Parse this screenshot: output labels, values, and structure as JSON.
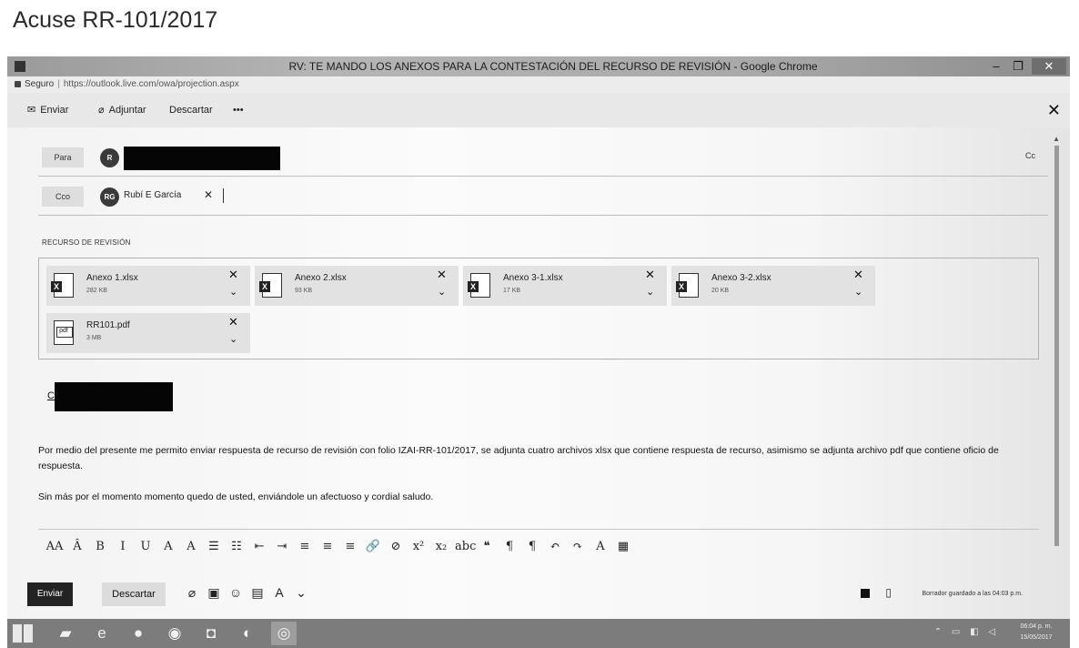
{
  "page_title": "Acuse RR-101/2017",
  "window": {
    "title": "RV: TE MANDO LOS ANEXOS PARA LA CONTESTACIÓN DEL RECURSO DE REVISIÓN - Google Chrome",
    "min_glyph": "–",
    "max_glyph": "❐",
    "close_glyph": "✕"
  },
  "address_bar": {
    "secure_label": "Seguro",
    "url": "https://outlook.live.com/owa/projection.aspx"
  },
  "toolbar": {
    "send_label": "Enviar",
    "attach_label": "Adjuntar",
    "discard_label": "Descartar",
    "more_label": "•••",
    "close_glyph": "✕"
  },
  "recipients": {
    "to_label": "Para",
    "to_avatar_initials": "R",
    "cc_label": "Cc",
    "bcc_label": "Cco",
    "bcc_avatar_initials": "RG",
    "bcc_name": "Rubí E García",
    "remove_glyph": "✕"
  },
  "subject": "RECURSO DE REVISIÓN",
  "attachments": [
    {
      "name": "Anexo 1.xlsx",
      "size": "282 KB",
      "icon": "excel-file-icon"
    },
    {
      "name": "Anexo 2.xlsx",
      "size": "93 KB",
      "icon": "excel-file-icon"
    },
    {
      "name": "Anexo 3-1.xlsx",
      "size": "17 KB",
      "icon": "excel-file-icon"
    },
    {
      "name": "Anexo 3-2.xlsx",
      "size": "20 KB",
      "icon": "excel-file-icon"
    },
    {
      "name": "RR101.pdf",
      "size": "3 MB",
      "icon": "pdf-file-icon"
    }
  ],
  "attachment_controls": {
    "remove_glyph": "✕",
    "more_glyph": "⌄"
  },
  "body": {
    "greeting": "C.",
    "paragraph_1": "Por medio del presente me permito enviar respuesta de recurso de revisión con folio IZAI-RR-101/2017, se adjunta cuatro archivos xlsx que contiene respuesta de recurso, asimismo se adjunta archivo pdf que contiene oficio de respuesta.",
    "paragraph_2": "Sin más por el momento momento quedo de usted, enviándole un afectuoso y cordial saludo."
  },
  "format_toolbar": [
    {
      "name": "font-size-icon",
      "glyph": "AA"
    },
    {
      "name": "grow-font-icon",
      "glyph": "Â"
    },
    {
      "name": "bold-icon",
      "glyph": "B"
    },
    {
      "name": "italic-icon",
      "glyph": "I"
    },
    {
      "name": "underline-icon",
      "glyph": "U"
    },
    {
      "name": "highlight-icon",
      "glyph": "A"
    },
    {
      "name": "font-color-icon",
      "glyph": "A"
    },
    {
      "name": "bullets-icon",
      "glyph": "☰"
    },
    {
      "name": "numbering-icon",
      "glyph": "☷"
    },
    {
      "name": "decrease-indent-icon",
      "glyph": "⇤"
    },
    {
      "name": "increase-indent-icon",
      "glyph": "⇥"
    },
    {
      "name": "align-left-icon",
      "glyph": "≡"
    },
    {
      "name": "align-center-icon",
      "glyph": "≡"
    },
    {
      "name": "align-right-icon",
      "glyph": "≡"
    },
    {
      "name": "insert-link-icon",
      "glyph": "🔗"
    },
    {
      "name": "remove-link-icon",
      "glyph": "⊘"
    },
    {
      "name": "superscript-icon",
      "glyph": "x²"
    },
    {
      "name": "subscript-icon",
      "glyph": "x₂"
    },
    {
      "name": "strikethrough-icon",
      "glyph": "abc"
    },
    {
      "name": "quote-icon",
      "glyph": "❝"
    },
    {
      "name": "ltr-icon",
      "glyph": "¶"
    },
    {
      "name": "rtl-icon",
      "glyph": "¶"
    },
    {
      "name": "undo-icon",
      "glyph": "↶"
    },
    {
      "name": "redo-icon",
      "glyph": "↷"
    },
    {
      "name": "clear-format-icon",
      "glyph": "A"
    },
    {
      "name": "insert-table-icon",
      "glyph": "▦"
    }
  ],
  "bottom_bar": {
    "send_label": "Enviar",
    "discard_label": "Descartar",
    "attach_glyph": "⌀",
    "image_glyph": "▣",
    "emoji_glyph": "☺",
    "calendar_glyph": "▤",
    "format_glyph": "A",
    "expand_glyph": "⌄",
    "save_status": "Borrador guardado a las 04:03 p.m.",
    "draft_glyph": "▯"
  },
  "taskbar": {
    "tray_glyphs": "⌃ ▭ ◧ ◁",
    "time": "06:04 p. m.",
    "date": "15/05/2017"
  }
}
